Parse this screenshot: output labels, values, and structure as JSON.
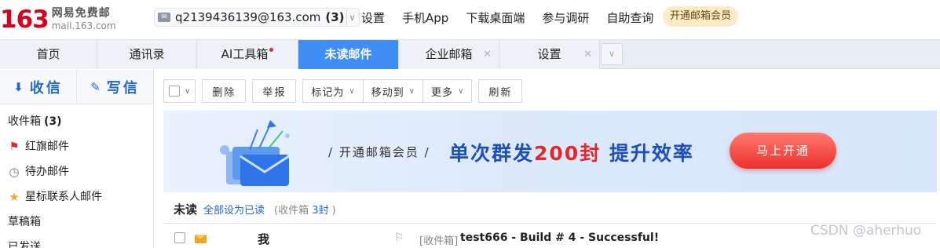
{
  "logo": {
    "number": "163",
    "brand_cn": "网易免费邮",
    "url": "mail.163.com"
  },
  "account": {
    "email": "q2139436139@163.com",
    "unread": "(3)"
  },
  "top_links": [
    "设置",
    "手机App",
    "下载桌面端",
    "参与调研",
    "自助查询"
  ],
  "vip_label": "开通邮箱会员",
  "tabs": [
    {
      "label": "首页",
      "closable": false,
      "active": false
    },
    {
      "label": "通讯录",
      "closable": false,
      "active": false
    },
    {
      "label": "AI工具箱",
      "closable": false,
      "active": false,
      "dot": true
    },
    {
      "label": "未读邮件",
      "closable": false,
      "active": true
    },
    {
      "label": "企业邮箱",
      "closable": true,
      "active": false
    },
    {
      "label": "设置",
      "closable": true,
      "active": false
    }
  ],
  "sidebar": {
    "receive_label": "收信",
    "compose_label": "写信",
    "folders": [
      {
        "label": "收件箱",
        "count": "(3)",
        "icon": "none"
      },
      {
        "label": "红旗邮件",
        "icon": "red-flag-icon"
      },
      {
        "label": "待办邮件",
        "icon": "clock-icon"
      },
      {
        "label": "星标联系人邮件",
        "icon": "star-icon"
      },
      {
        "label": "草稿箱",
        "icon": "none"
      },
      {
        "label": "已发送",
        "icon": "none"
      }
    ]
  },
  "toolbar": {
    "delete": "删除",
    "report": "举报",
    "mark_as": "标记为",
    "move_to": "移动到",
    "more": "更多",
    "refresh": "刷新"
  },
  "banner": {
    "label": "/ 开通邮箱会员 /",
    "title_prefix": "单次群发",
    "title_highlight": "200封",
    "title_suffix": " 提升效率",
    "button": "马上开通"
  },
  "list_header": {
    "title": "未读",
    "mark_all_read": "全部设为已读",
    "info_prefix": "(收件箱 ",
    "info_count": "3封",
    "info_suffix": " )"
  },
  "mail": {
    "sender": "我",
    "folder": "[收件箱]",
    "subject": "test666 - Build # 4 - Successful!"
  },
  "watermark": "CSDN @aherhuo",
  "colors": {
    "accent": "#3f8ef5",
    "brand_red": "#d5001c",
    "link_blue": "#2168d3"
  }
}
